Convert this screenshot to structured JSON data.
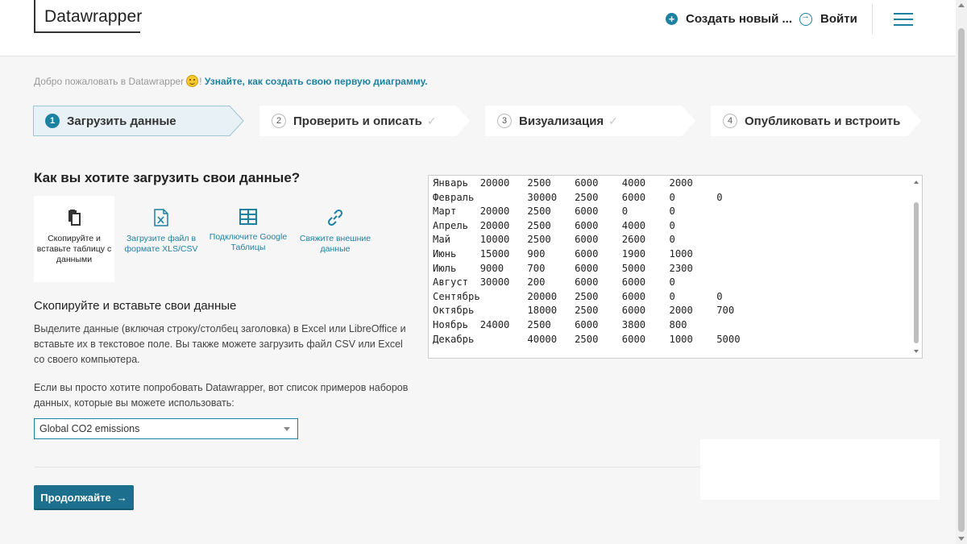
{
  "header": {
    "logo": "Datawrapper",
    "create_label": "Создать новый ...",
    "login_label": "Войти"
  },
  "welcome": {
    "text": "Добро пожаловать в Datawrapper",
    "link": "Узнайте, как создать свою первую диаграмму."
  },
  "steps": [
    {
      "num": "1",
      "label": "Загрузить данные",
      "active": true,
      "checked": false
    },
    {
      "num": "2",
      "label": "Проверить и описать",
      "active": false,
      "checked": true
    },
    {
      "num": "3",
      "label": "Визуализация",
      "active": false,
      "checked": true
    },
    {
      "num": "4",
      "label": "Опубликовать и встроить",
      "active": false,
      "checked": false
    }
  ],
  "upload": {
    "heading": "Как вы хотите загрузить свои данные?",
    "options": [
      {
        "label": "Скопируйте и вставьте таблицу с данными",
        "icon": "clipboard-icon",
        "active": true
      },
      {
        "label": "Загрузите файл в формате XLS/CSV",
        "icon": "excel-file-icon",
        "active": false
      },
      {
        "label": "Подключите Google Таблицы",
        "icon": "table-grid-icon",
        "active": false
      },
      {
        "label": "Свяжите внешние данные",
        "icon": "link-icon",
        "active": false
      }
    ]
  },
  "paste": {
    "heading": "Скопируйте и вставьте свои данные",
    "paragraph1": "Выделите данные (включая строку/столбец заголовка) в Excel или LibreOffice и вставьте их в текстовое поле. Вы также можете загрузить файл CSV или Excel со своего компьютера.",
    "paragraph2": "Если вы просто хотите попробовать Datawrapper, вот список примеров наборов данных, которые вы можете использовать:",
    "sample_select": "Global CO2 emissions"
  },
  "data_text": "Январь  20000   2500    6000    4000    2000\nФевраль         30000   2500    6000    0       0\nМарт    20000   2500    6000    0       0\nАпрель  20000   2500    6000    4000    0\nМай     10000   2500    6000    2600    0\nИюнь    15000   900     6000    1900    1000\nИюль    9000    700     6000    5000    2300\nАвгуст  30000   200     6000    6000    0\nСентябрь        20000   2500    6000    0       0\nОктябрь         18000   2500    6000    2000    700\nНоябрь  24000   2500    6000    3800    800\nДекабрь         40000   2500    6000    1000    5000",
  "continue_label": "Продолжайте",
  "colors": {
    "accent": "#1d81a2",
    "button": "#1d6f8e",
    "active_step_bg": "#e8f1f6"
  }
}
